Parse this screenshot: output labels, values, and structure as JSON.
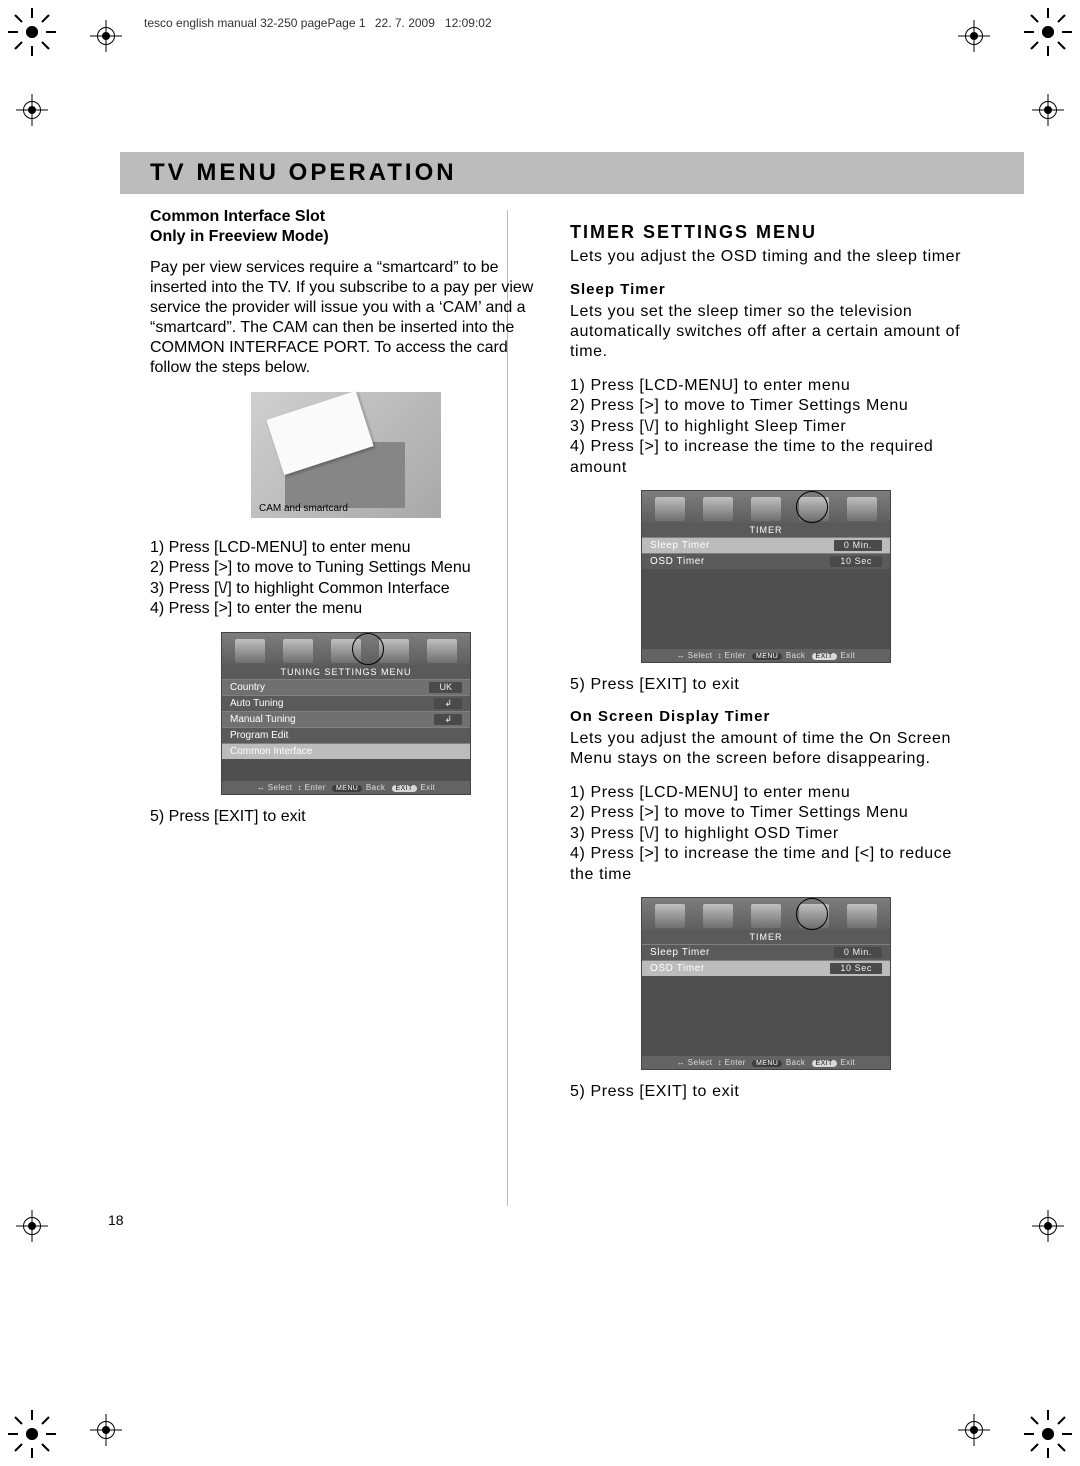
{
  "meta": {
    "file": "tesco english manual 32-250 pagePage 1",
    "date": "22. 7. 2009",
    "time": "12:09:02"
  },
  "title": "TV MENU OPERATION",
  "page_number": "18",
  "left": {
    "section_title": "Common Interface Slot",
    "section_sub": "Only in Freeview Mode)",
    "para": "Pay per view services require a “smartcard” to be inserted into the TV. If you subscribe to a pay per view service the provider will issue you with a ‘CAM’ and a “smartcard”. The CAM can then be inserted into the COMMON INTERFACE PORT. To access the card follow the steps below.",
    "cam_caption": "CAM and smartcard",
    "steps_a": "1) Press [LCD-MENU] to enter menu\n2) Press [>] to move to Tuning Settings Menu\n3) Press [\\/] to highlight Common Interface\n4) Press [>] to enter the menu",
    "menu": {
      "title": "TUNING SETTINGS MENU",
      "rows": [
        {
          "k": "Country",
          "v": "UK"
        },
        {
          "k": "Auto Tuning",
          "v": "↲"
        },
        {
          "k": "Manual Tuning",
          "v": "↲"
        },
        {
          "k": "Program Edit",
          "v": ""
        }
      ],
      "selected": {
        "k": "Common Interface",
        "v": ""
      },
      "foot_select": "Select",
      "foot_enter": "Enter",
      "foot_menu": "MENU",
      "foot_back": "Back",
      "foot_exit_pill": "EXIT",
      "foot_exit": "Exit"
    },
    "step_5": "5) Press [EXIT] to exit"
  },
  "right": {
    "heading": "TIMER SETTINGS MENU",
    "intro": "Lets you adjust the OSD timing and the sleep timer",
    "sleep": {
      "head": "Sleep Timer",
      "para": "Lets you set the sleep timer so the television automatically switches off after a certain amount of time.",
      "steps": "1) Press [LCD-MENU] to enter menu\n2) Press [>] to move to Timer Settings Menu\n3) Press [\\/] to highlight Sleep Timer\n4) Press [>] to increase the time to the required amount",
      "menu": {
        "title": "TIMER",
        "rows": [
          {
            "k": "Sleep Timer",
            "v": "0 Min."
          },
          {
            "k": "OSD Timer",
            "v": "10 Sec"
          }
        ],
        "sel_index": 0,
        "foot_select": "Select",
        "foot_enter": "Enter",
        "foot_menu": "MENU",
        "foot_back": "Back",
        "foot_exit_pill": "EXIT",
        "foot_exit": "Exit"
      },
      "step_5": "5) Press [EXIT] to exit"
    },
    "osd": {
      "head": "On Screen Display Timer",
      "para": "Lets you adjust the amount of time the On Screen Menu stays on the screen before disappearing.",
      "steps": "1) Press [LCD-MENU] to enter menu\n2) Press [>] to move to Timer Settings Menu\n3) Press [\\/] to highlight OSD Timer\n4) Press [>] to increase the time and [<] to reduce the time",
      "menu": {
        "title": "TIMER",
        "rows": [
          {
            "k": "Sleep Timer",
            "v": "0 Min."
          },
          {
            "k": "OSD Timer",
            "v": "10 Sec"
          }
        ],
        "sel_index": 1,
        "foot_select": "Select",
        "foot_enter": "Enter",
        "foot_menu": "MENU",
        "foot_back": "Back",
        "foot_exit_pill": "EXIT",
        "foot_exit": "Exit"
      },
      "step_5": "5) Press [EXIT] to exit"
    }
  }
}
